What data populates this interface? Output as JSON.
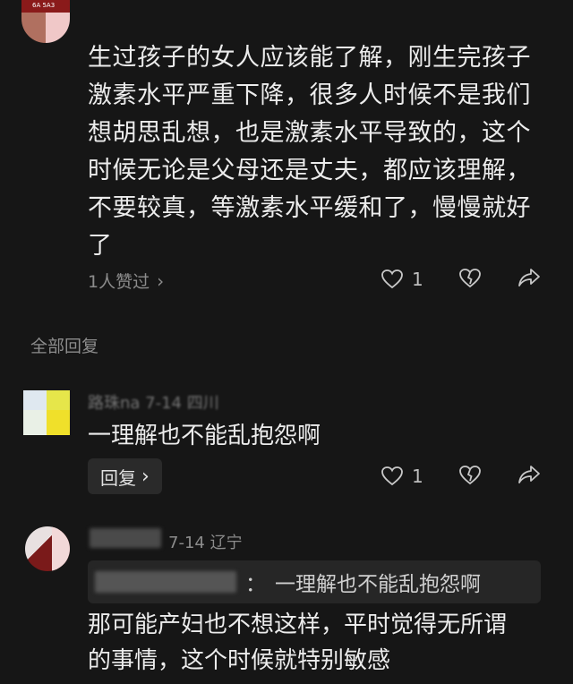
{
  "comment": {
    "text_lines": [
      "生过孩子的女人应该能了解，刚生完孩子",
      "激素水平严重下降，很多人时候不是我们",
      "想胡思乱想，也是激素水平导致的，这个",
      "时候无论是父母还是丈夫，都应该理解，",
      "不要较真，等激素水平缓和了，慢慢就好",
      "了"
    ],
    "likes_summary": "1人赞过",
    "like_count": "1",
    "avatar_text": "6A 5A3"
  },
  "replies_header": "全部回复",
  "reply1": {
    "meta": "路珠na  7-14  四川",
    "text": "一理解也不能乱抱怨啊",
    "reply_button": "回复",
    "like_count": "1"
  },
  "reply2": {
    "meta": "7-14  辽宁",
    "quote_prefix": "：",
    "quote_text": "一理解也不能乱抱怨啊",
    "text_lines": [
      "那可能产妇也不想这样，平时觉得无所谓",
      "的事情，这个时候就特别敏感"
    ]
  },
  "colors": {
    "background": "#161616",
    "text": "#ececec",
    "muted": "#8c8c8c"
  }
}
